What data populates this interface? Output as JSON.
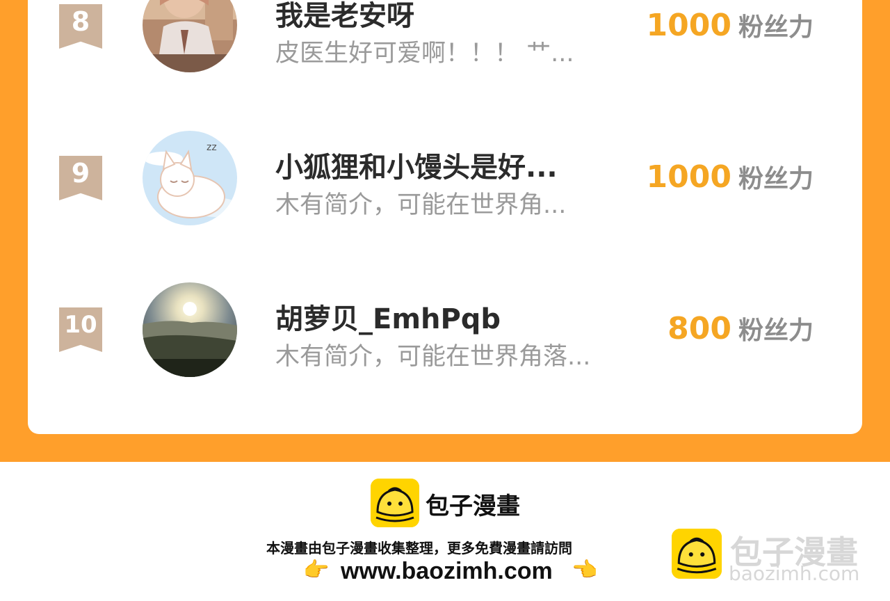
{
  "ranking": [
    {
      "rank": "8",
      "name": "我是老安呀",
      "bio": "皮医生好可爱啊！！！ 艹...",
      "fans": "1000",
      "unit": "粉丝力",
      "avatar": "anime-girl-avatar"
    },
    {
      "rank": "9",
      "name": "小狐狸和小馒头是好...",
      "bio": "木有简介，可能在世界角...",
      "fans": "1000",
      "unit": "粉丝力",
      "avatar": "sleeping-cat-avatar"
    },
    {
      "rank": "10",
      "name": "胡萝贝_EmhPqb",
      "bio": "木有简介，可能在世界角落...",
      "fans": "800",
      "unit": "粉丝力",
      "avatar": "sunrise-landscape-avatar"
    }
  ],
  "footer": {
    "brand": "包子漫畫",
    "notice": "本漫畫由包子漫畫收集整理，更多免費漫畫請訪問",
    "url": "www.baozimh.com",
    "left_hand": "👉",
    "right_hand": "👈"
  },
  "watermark": {
    "brand": "包子漫畫",
    "url": "baozimh.com"
  },
  "colors": {
    "panel": "#FF9F2B",
    "rank_badge": "#CDB39C",
    "fans_number": "#F5A623",
    "logo": "#FFD400"
  }
}
